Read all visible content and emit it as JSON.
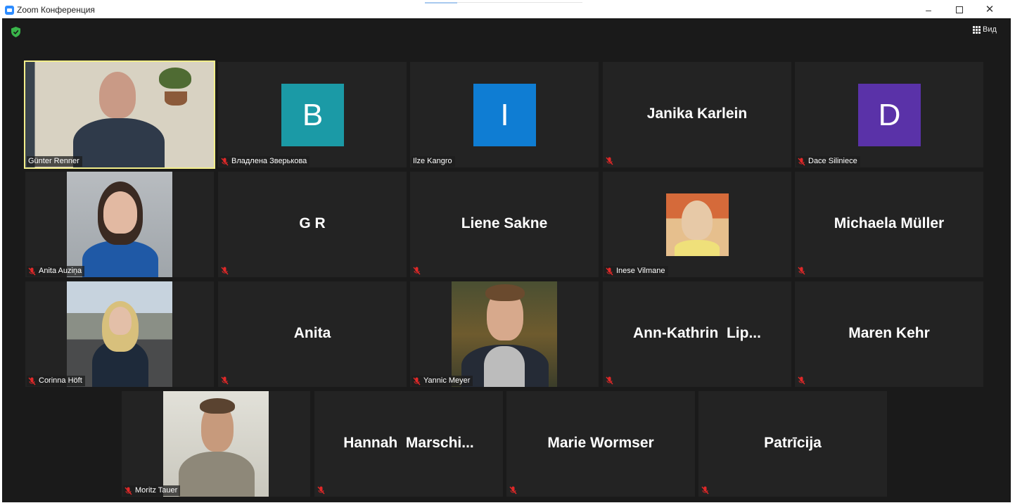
{
  "window": {
    "title": "Zoom Конференция",
    "minimize_glyph": "–",
    "close_glyph": "✕"
  },
  "toolbar": {
    "view_label": "Вид",
    "security_icon": "shield-check-icon",
    "security_color": "#39b54a"
  },
  "colors": {
    "speaker_highlight": "#f2ee8a",
    "tile_bg": "#232323",
    "avatar_teal": "#1b9aa6",
    "avatar_blue": "#0f7dd3",
    "avatar_purple": "#5a32a8"
  },
  "tiles": [
    {
      "name": "Günter Renner",
      "kind": "video",
      "muted": false
    },
    {
      "name": "Владлена Зверькова",
      "kind": "avatar",
      "initial": "B",
      "muted": true
    },
    {
      "name": "Ilze Kangro",
      "kind": "avatar",
      "initial": "I",
      "muted": false
    },
    {
      "display": "Janika Karlein",
      "kind": "name",
      "muted": true
    },
    {
      "name": "Dace Siliniece",
      "kind": "avatar",
      "initial": "D",
      "muted": true
    },
    {
      "name": "Anita Auziņa",
      "kind": "video",
      "muted": true
    },
    {
      "display": "G R",
      "kind": "name",
      "muted": true
    },
    {
      "display": "Liene Sakne",
      "kind": "name",
      "muted": true
    },
    {
      "name": "Inese Vilmane",
      "kind": "photo",
      "muted": true
    },
    {
      "display": "Michaela Müller",
      "kind": "name",
      "muted": true
    },
    {
      "name": "Corinna Höft",
      "kind": "video",
      "muted": true
    },
    {
      "display": "Anita",
      "kind": "name",
      "muted": true
    },
    {
      "name": "Yannic Meyer",
      "kind": "video",
      "muted": true
    },
    {
      "display": "Ann-Kathrin  Lip...",
      "kind": "name",
      "muted": true
    },
    {
      "display": "Maren Kehr",
      "kind": "name",
      "muted": true
    },
    {
      "name": "Moritz Tauer",
      "kind": "video",
      "muted": true
    },
    {
      "display": "Hannah  Marschi...",
      "kind": "name",
      "muted": true
    },
    {
      "display": "Marie Wormser",
      "kind": "name",
      "muted": true
    },
    {
      "display": "Patrīcija",
      "kind": "name",
      "muted": true
    }
  ]
}
